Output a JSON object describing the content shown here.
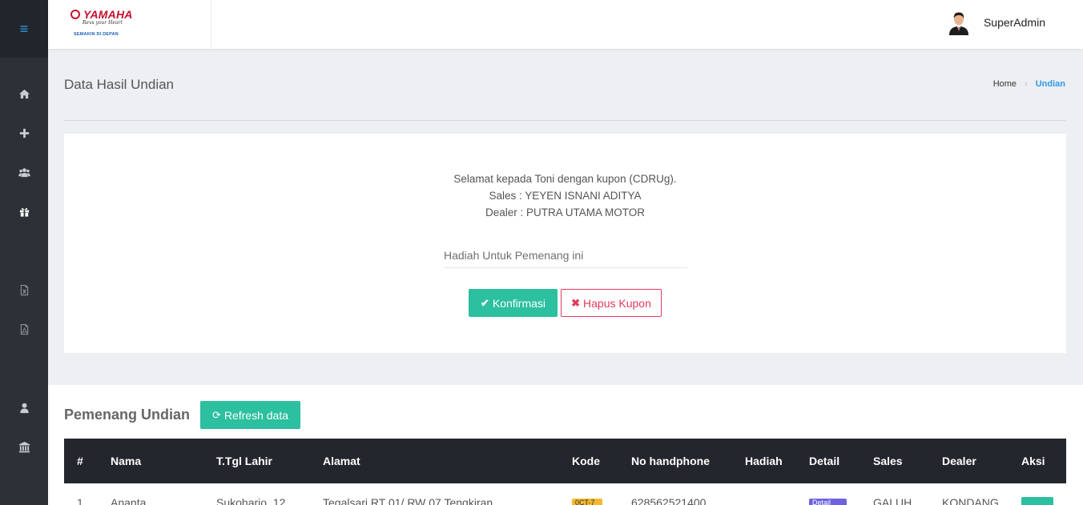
{
  "topbar": {
    "user_name": "SuperAdmin"
  },
  "logo": {
    "brand": "YAMAHA",
    "tagline": "Revs your Heart",
    "sub": "SEMAKIN DI DEPAN"
  },
  "sidebar": {
    "menu_icon": "hamburger-icon",
    "items": [
      {
        "icon": "home-icon"
      },
      {
        "icon": "plus-icon"
      },
      {
        "icon": "users-icon"
      },
      {
        "icon": "gift-icon",
        "active": true
      },
      {
        "icon": "excel-file-icon"
      },
      {
        "icon": "pdf-file-icon"
      },
      {
        "icon": "user-icon"
      },
      {
        "icon": "bank-icon"
      }
    ]
  },
  "page": {
    "title": "Data Hasil Undian",
    "breadcrumb": {
      "home": "Home",
      "current": "Undian"
    }
  },
  "winner": {
    "line1": "Selamat kepada Toni dengan kupon (CDRUg).",
    "line2": "Sales : YEYEN ISNANI ADITYA",
    "line3": "Dealer : PUTRA UTAMA MOTOR",
    "prize_placeholder": "Hadiah Untuk Pemenang ini",
    "confirm_label": "Konfirmasi",
    "delete_label": "Hapus Kupon"
  },
  "winners_table": {
    "title": "Pemenang Undian",
    "refresh_label": "Refresh data",
    "columns": [
      "#",
      "Nama",
      "T.Tgl Lahir",
      "Alamat",
      "Kode",
      "No handphone",
      "Hadiah",
      "Detail",
      "Sales",
      "Dealer",
      "Aksi"
    ],
    "rows": [
      {
        "no": "1",
        "nama": "Ananta",
        "ttl": "Sukoharjo, 12",
        "alamat": "Tegalsari RT 01/ RW 07 Tengkiran",
        "kode": "0CT-7",
        "hp": "628562521400",
        "hadiah": "",
        "detail": "Detail",
        "sales": "GALUH",
        "dealer": "KONDANG"
      }
    ]
  },
  "colors": {
    "accent": "#2cbfa0",
    "danger": "#e53a5c",
    "link": "#2e9ae8",
    "sidebar": "#2c3138",
    "table_head": "#23272d"
  }
}
